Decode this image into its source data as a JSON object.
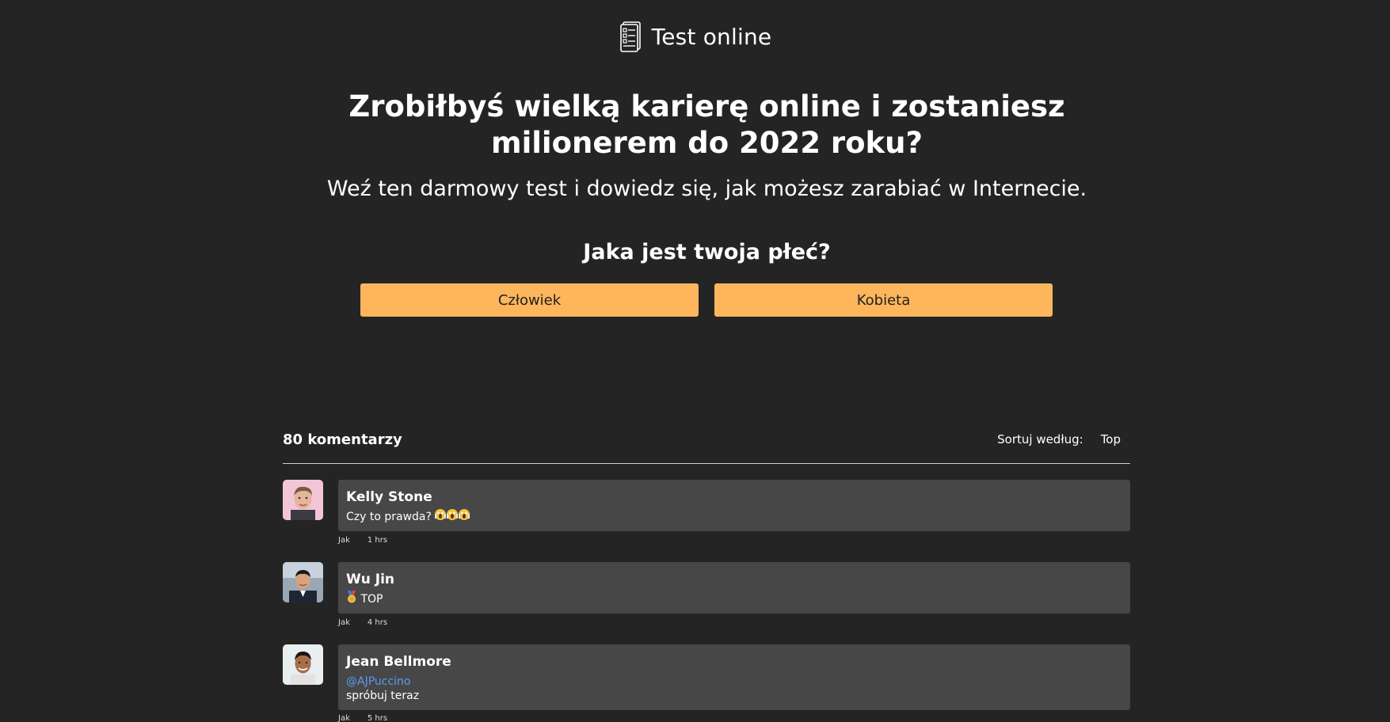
{
  "brand": {
    "title": "Test online",
    "icon": "test-document-icon"
  },
  "hero": {
    "headline": "Zrobiłbyś wielką karierę online i zostaniesz milionerem do 2022 roku?",
    "subheadline": "Weź ten darmowy test i dowiedz się, jak możesz zarabiać w Internecie."
  },
  "quiz": {
    "question": "Jaka jest twoja płeć?",
    "options": [
      "Człowiek",
      "Kobieta"
    ],
    "button_color": "#feb65d"
  },
  "comments": {
    "count_label": "80 komentarzy",
    "sort_label": "Sortuj według:",
    "sort_value": "Top",
    "items": [
      {
        "author": "Kelly Stone",
        "text": "Czy to prawda?",
        "emoji": "scream-emoji x3",
        "like_label": "Jak",
        "time": "1 hrs"
      },
      {
        "author": "Wu Jin",
        "text": "TOP",
        "emoji": "medal-emoji",
        "like_label": "Jak",
        "time": "4 hrs"
      },
      {
        "author": "Jean Bellmore",
        "mention": "@AJPuccino",
        "text": "spróbuj teraz",
        "like_label": "Jak",
        "time": "5 hrs"
      }
    ]
  },
  "colors": {
    "background": "#242424",
    "comment_bubble": "#474747",
    "mention": "#5b9bf0"
  }
}
